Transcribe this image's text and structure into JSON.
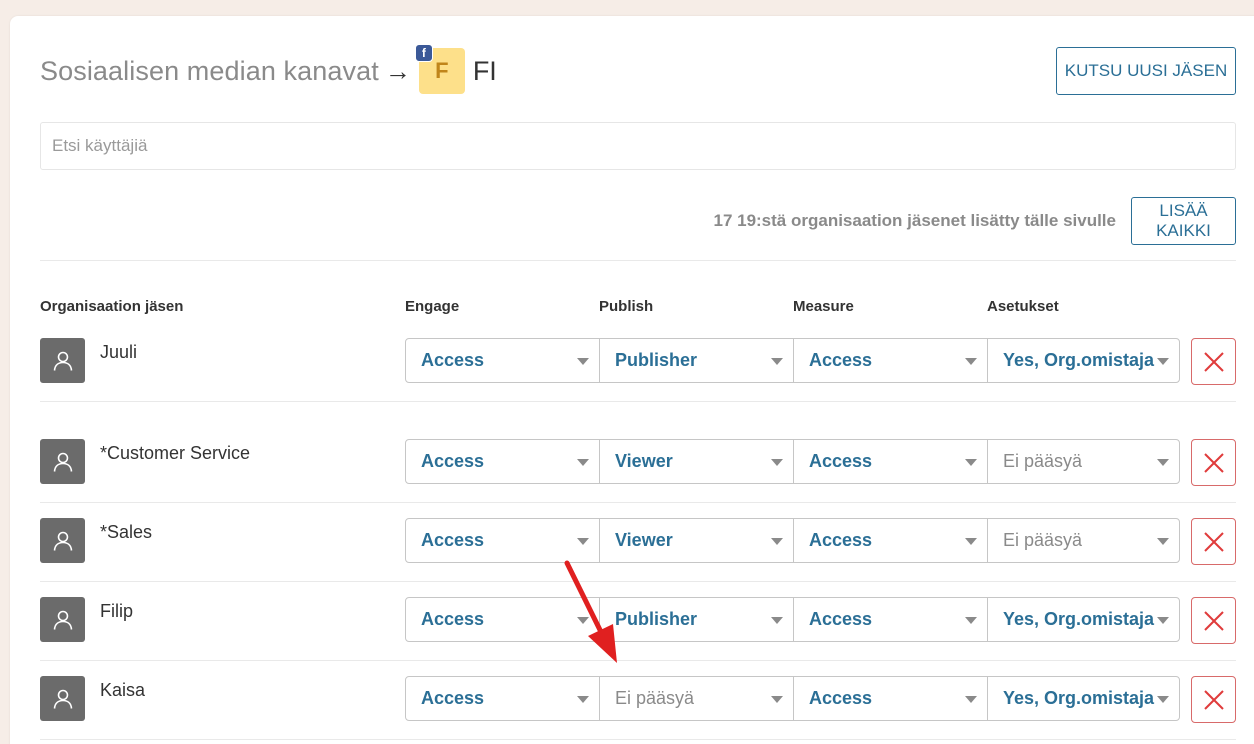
{
  "header": {
    "title": "Sosiaalisen median kanavat",
    "arrow": "→",
    "channel_initial": "F",
    "channel_badge": "f",
    "channel_name": "FI",
    "invite_label": "KUTSU UUSI JÄSEN"
  },
  "search": {
    "placeholder": "Etsi käyttäjiä"
  },
  "summary": {
    "text": "17 19:stä organisaation jäsenet lisätty tälle sivulle",
    "add_all_label": "LISÄÄ KAIKKI"
  },
  "columns": {
    "member": "Organisaation jäsen",
    "engage": "Engage",
    "publish": "Publish",
    "measure": "Measure",
    "settings": "Asetukset"
  },
  "members": [
    {
      "name": "Juuli",
      "engage": "Access",
      "publish": "Publisher",
      "measure": "Access",
      "settings": "Yes, Org.omistaja"
    },
    {
      "name": "*Customer Service",
      "engage": "Access",
      "publish": "Viewer",
      "measure": "Access",
      "settings": "Ei pääsyä"
    },
    {
      "name": "*Sales",
      "engage": "Access",
      "publish": "Viewer",
      "measure": "Access",
      "settings": "Ei pääsyä"
    },
    {
      "name": "Filip",
      "engage": "Access",
      "publish": "Publisher",
      "measure": "Access",
      "settings": "Yes, Org.omistaja"
    },
    {
      "name": "Kaisa",
      "engage": "Access",
      "publish": "Ei pääsyä",
      "measure": "Access",
      "settings": "Yes, Org.omistaja"
    }
  ],
  "colors": {
    "accent": "#2b6f96",
    "muted": "#8a8a8a",
    "danger": "#e03c3c",
    "annotation_arrow": "#e02020",
    "channel_avatar": "#fde08a",
    "facebook": "#3b5998"
  }
}
